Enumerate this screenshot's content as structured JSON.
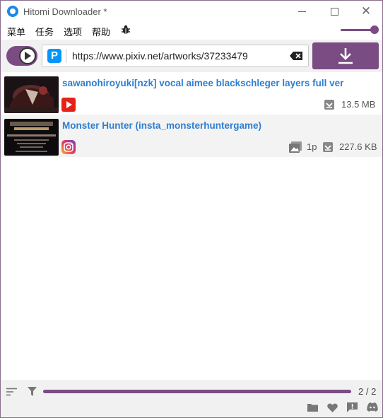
{
  "window": {
    "title": "Hitomi Downloader *",
    "close_glyph": "✕"
  },
  "menu": [
    "菜单",
    "任务",
    "选项",
    "帮助"
  ],
  "toolbar": {
    "url_value": "https://www.pixiv.net/artworks/37233479",
    "site_icon_letter": "P"
  },
  "tasks": [
    {
      "title": "sawanohiroyuki[nzk] vocal aimee blackschleger layers full ver",
      "site": "youtube-icon",
      "size": "13.5 MB"
    },
    {
      "title": "Monster Hunter (insta_monsterhuntergame)",
      "site": "instagram-icon",
      "pages": "1p",
      "size": "227.6 KB"
    }
  ],
  "status": {
    "progress": 1.0,
    "page_count": "2 / 2"
  },
  "colors": {
    "accent": "#7b4c83",
    "link": "#2f7fd0"
  }
}
